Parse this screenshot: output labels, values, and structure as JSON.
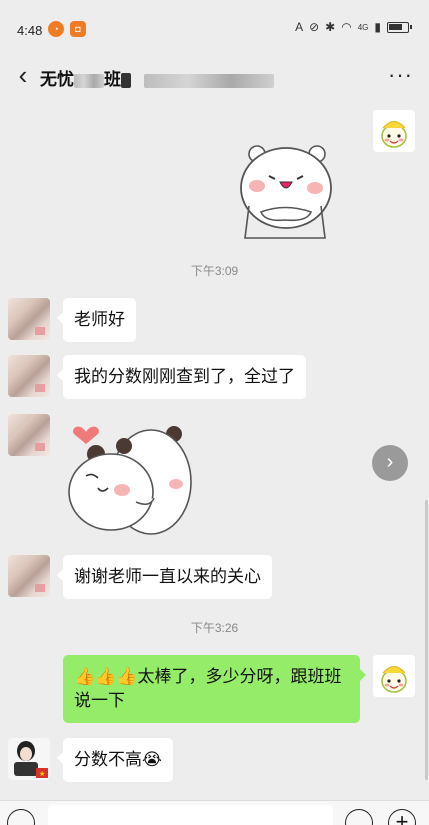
{
  "status_bar": {
    "time": "4:48",
    "network": "4G"
  },
  "nav": {
    "back_icon": "‹",
    "title": "无忧",
    "title_suffix": "班",
    "more_icon": "···"
  },
  "messages": {
    "t1": "下午3:09",
    "m1": "老师好",
    "m2": "我的分数刚刚查到了，全过了",
    "m3": "谢谢老师一直以来的关心",
    "t2": "下午3:26",
    "m4": "👍👍👍太棒了，多少分呀，跟班班说一下",
    "m5": "分数不高😭"
  },
  "controls": {
    "forward_icon": "›",
    "plus_icon": "+"
  },
  "colors": {
    "background": "#ededed",
    "sent_bubble": "#95ec69",
    "received_bubble": "#ffffff"
  }
}
